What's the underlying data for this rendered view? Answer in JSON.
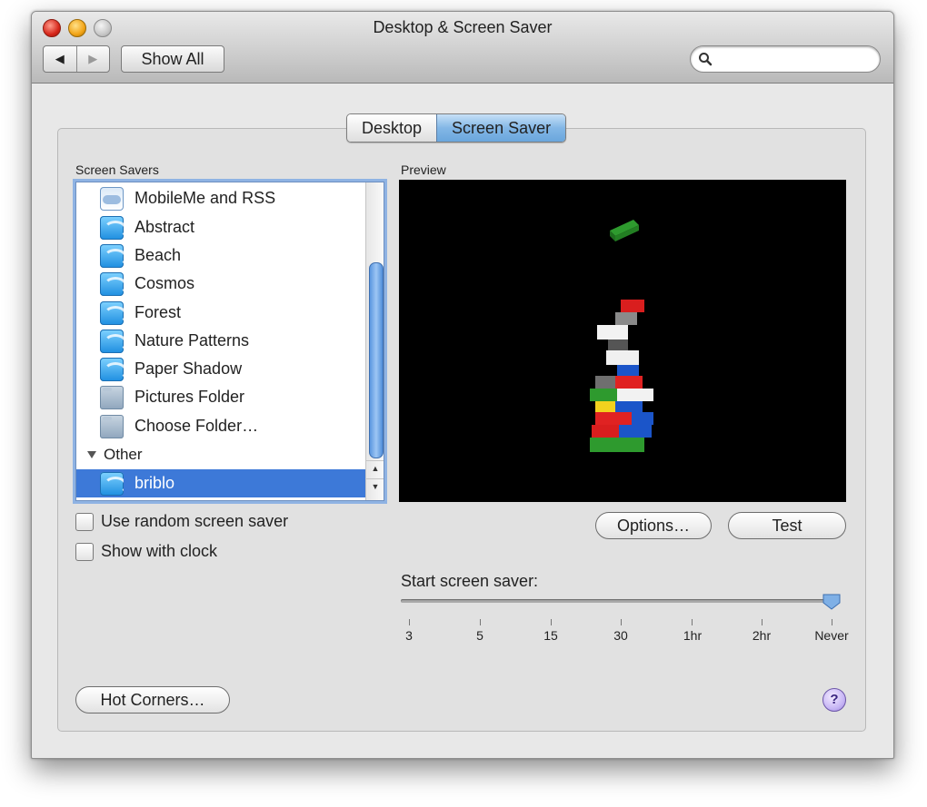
{
  "window": {
    "title": "Desktop & Screen Saver",
    "nav_back": "◀",
    "nav_forward": "▶",
    "show_all": "Show All",
    "search_placeholder": ""
  },
  "tabs": [
    {
      "label": "Desktop",
      "active": false
    },
    {
      "label": "Screen Saver",
      "active": true
    }
  ],
  "screen_savers": {
    "label": "Screen Savers",
    "items": [
      {
        "label": "MobileMe and RSS",
        "icon": "cloud-icon"
      },
      {
        "label": "Abstract",
        "icon": "screensaver-icon"
      },
      {
        "label": "Beach",
        "icon": "screensaver-icon"
      },
      {
        "label": "Cosmos",
        "icon": "screensaver-icon"
      },
      {
        "label": "Forest",
        "icon": "screensaver-icon"
      },
      {
        "label": "Nature Patterns",
        "icon": "screensaver-icon"
      },
      {
        "label": "Paper Shadow",
        "icon": "screensaver-icon"
      },
      {
        "label": "Pictures Folder",
        "icon": "folder-icon"
      },
      {
        "label": "Choose Folder…",
        "icon": "folder-icon"
      }
    ],
    "group_other": "Other",
    "selected_item": "briblo"
  },
  "preview": {
    "label": "Preview"
  },
  "options": {
    "random_label": "Use random screen saver",
    "random_checked": false,
    "clock_label": "Show with clock",
    "clock_checked": false,
    "options_button": "Options…",
    "test_button": "Test",
    "hot_corners_button": "Hot Corners…",
    "help_button": "?"
  },
  "slider": {
    "label": "Start screen saver:",
    "ticks": [
      "3",
      "5",
      "15",
      "30",
      "1hr",
      "2hr",
      "Never"
    ],
    "selected": "Never"
  },
  "colors": {
    "selection": "#3d79d8",
    "tab_active": "#83b7e6",
    "window_bg": "#e8e8e8"
  }
}
